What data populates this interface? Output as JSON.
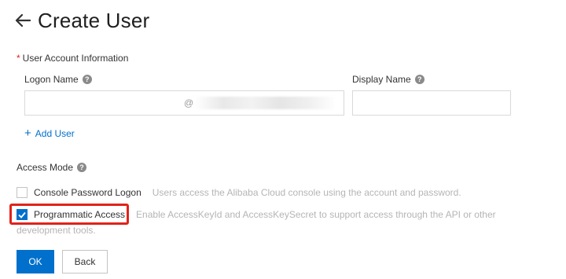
{
  "header": {
    "title": "Create User",
    "back_icon": "arrow-left-icon"
  },
  "account_section": {
    "required_mark": "*",
    "label": "User Account Information"
  },
  "fields": {
    "logon_name_label": "Logon Name",
    "logon_name_value": "",
    "logon_domain_prefix": "@",
    "display_name_label": "Display Name",
    "display_name_value": ""
  },
  "add_user": {
    "icon": "+",
    "label": "Add User"
  },
  "access_mode": {
    "label": "Access Mode",
    "options": [
      {
        "label": "Console Password Logon",
        "checked": false,
        "description": "Users access the Alibaba Cloud console using the account and password."
      },
      {
        "label": "Programmatic Access",
        "checked": true,
        "description_line1": "Enable AccessKeyId and AccessKeySecret to support access through the API or other",
        "description_line2": "development tools."
      }
    ]
  },
  "buttons": {
    "ok": "OK",
    "back": "Back"
  },
  "colors": {
    "accent": "#0070cc",
    "highlight": "#e0231b",
    "required": "#e02020"
  }
}
